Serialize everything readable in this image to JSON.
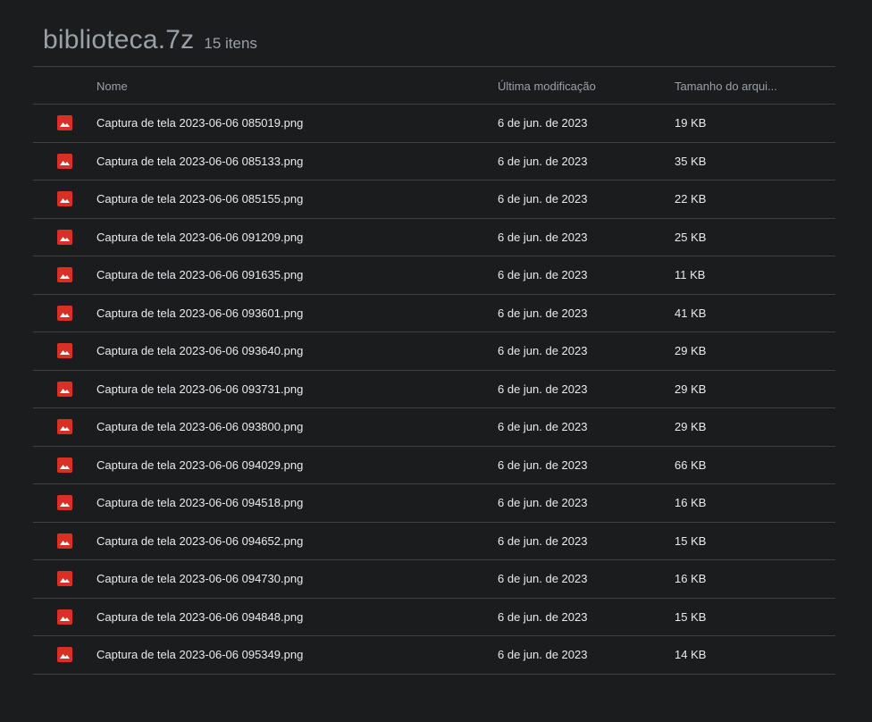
{
  "header": {
    "title": "biblioteca.7z",
    "count": "15 itens"
  },
  "columns": {
    "name": "Nome",
    "modified": "Última modificação",
    "size": "Tamanho do arqui..."
  },
  "files": [
    {
      "name": "Captura de tela 2023-06-06 085019.png",
      "modified": "6 de jun. de 2023",
      "size": "19 KB",
      "icon": "image-file-icon"
    },
    {
      "name": "Captura de tela 2023-06-06 085133.png",
      "modified": "6 de jun. de 2023",
      "size": "35 KB",
      "icon": "image-file-icon"
    },
    {
      "name": "Captura de tela 2023-06-06 085155.png",
      "modified": "6 de jun. de 2023",
      "size": "22 KB",
      "icon": "image-file-icon"
    },
    {
      "name": "Captura de tela 2023-06-06 091209.png",
      "modified": "6 de jun. de 2023",
      "size": "25 KB",
      "icon": "image-file-icon"
    },
    {
      "name": "Captura de tela 2023-06-06 091635.png",
      "modified": "6 de jun. de 2023",
      "size": "11 KB",
      "icon": "image-file-icon"
    },
    {
      "name": "Captura de tela 2023-06-06 093601.png",
      "modified": "6 de jun. de 2023",
      "size": "41 KB",
      "icon": "image-file-icon"
    },
    {
      "name": "Captura de tela 2023-06-06 093640.png",
      "modified": "6 de jun. de 2023",
      "size": "29 KB",
      "icon": "image-file-icon"
    },
    {
      "name": "Captura de tela 2023-06-06 093731.png",
      "modified": "6 de jun. de 2023",
      "size": "29 KB",
      "icon": "image-file-icon"
    },
    {
      "name": "Captura de tela 2023-06-06 093800.png",
      "modified": "6 de jun. de 2023",
      "size": "29 KB",
      "icon": "image-file-icon"
    },
    {
      "name": "Captura de tela 2023-06-06 094029.png",
      "modified": "6 de jun. de 2023",
      "size": "66 KB",
      "icon": "image-file-icon"
    },
    {
      "name": "Captura de tela 2023-06-06 094518.png",
      "modified": "6 de jun. de 2023",
      "size": "16 KB",
      "icon": "image-file-icon"
    },
    {
      "name": "Captura de tela 2023-06-06 094652.png",
      "modified": "6 de jun. de 2023",
      "size": "15 KB",
      "icon": "image-file-icon"
    },
    {
      "name": "Captura de tela 2023-06-06 094730.png",
      "modified": "6 de jun. de 2023",
      "size": "16 KB",
      "icon": "image-file-icon"
    },
    {
      "name": "Captura de tela 2023-06-06 094848.png",
      "modified": "6 de jun. de 2023",
      "size": "15 KB",
      "icon": "image-file-icon"
    },
    {
      "name": "Captura de tela 2023-06-06 095349.png",
      "modified": "6 de jun. de 2023",
      "size": "14 KB",
      "icon": "image-file-icon"
    }
  ],
  "colors": {
    "background": "#1b1c1e",
    "divider": "#3c4043",
    "icon_red": "#d93025",
    "text": "#e8eaed",
    "muted_text": "#9aa0a6"
  }
}
